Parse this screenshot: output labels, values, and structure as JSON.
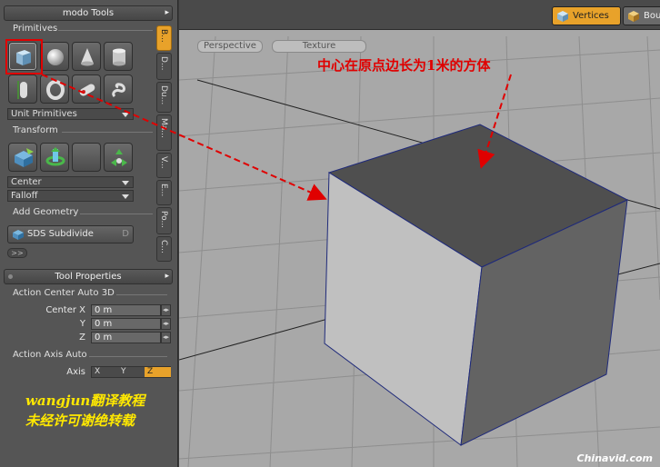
{
  "tool_panel": {
    "title": "modo Tools",
    "primitives_label": "Primitives",
    "primitives_row1": [
      "cube-icon",
      "sphere-icon",
      "cone-icon",
      "cylinder-icon"
    ],
    "primitives_row2": [
      "capsule-icon",
      "torus-icon",
      "pill-icon",
      "spiral-icon"
    ],
    "unit_primitives": "Unit Primitives",
    "transform_label": "Transform",
    "transform_tools": [
      "move-icon",
      "rotate-icon",
      "blank-icon",
      "scale-icon"
    ],
    "center_dropdown": "Center",
    "falloff_dropdown": "Falloff",
    "add_geometry_label": "Add Geometry",
    "sds_subdivide": "SDS Subdivide",
    "sds_key": "D",
    "more_button": ">>"
  },
  "vertical_tabs": [
    "B...",
    "D...",
    "Du...",
    "Ma...",
    "V...",
    "E...",
    "Po...",
    "C..."
  ],
  "tool_properties": {
    "title": "Tool Properties",
    "action_center_label": "Action Center Auto 3D",
    "center_x_label": "Center X",
    "center_x_value": "0 m",
    "y_label": "Y",
    "y_value": "0 m",
    "z_label": "Z",
    "z_value": "0 m",
    "action_axis_label": "Action Axis Auto",
    "axis_label": "Axis",
    "axis_options": [
      "X",
      "Y",
      "Z"
    ],
    "axis_selected": "Z"
  },
  "watermark": {
    "line1": "wangjun翻译教程",
    "line2": "未经许可谢绝转载"
  },
  "viewport": {
    "select_modes": [
      {
        "label": "Vertices",
        "active": true
      },
      {
        "label": "Bou",
        "active": false
      }
    ],
    "view_tabs": [
      "Perspective",
      "Texture"
    ],
    "annotation": "中心在原点边长为1米的方体",
    "credit": "Chinavid.com"
  },
  "colors": {
    "accent": "#e8a22a",
    "annotation_red": "#e00000",
    "watermark_yellow": "#ffe800"
  }
}
